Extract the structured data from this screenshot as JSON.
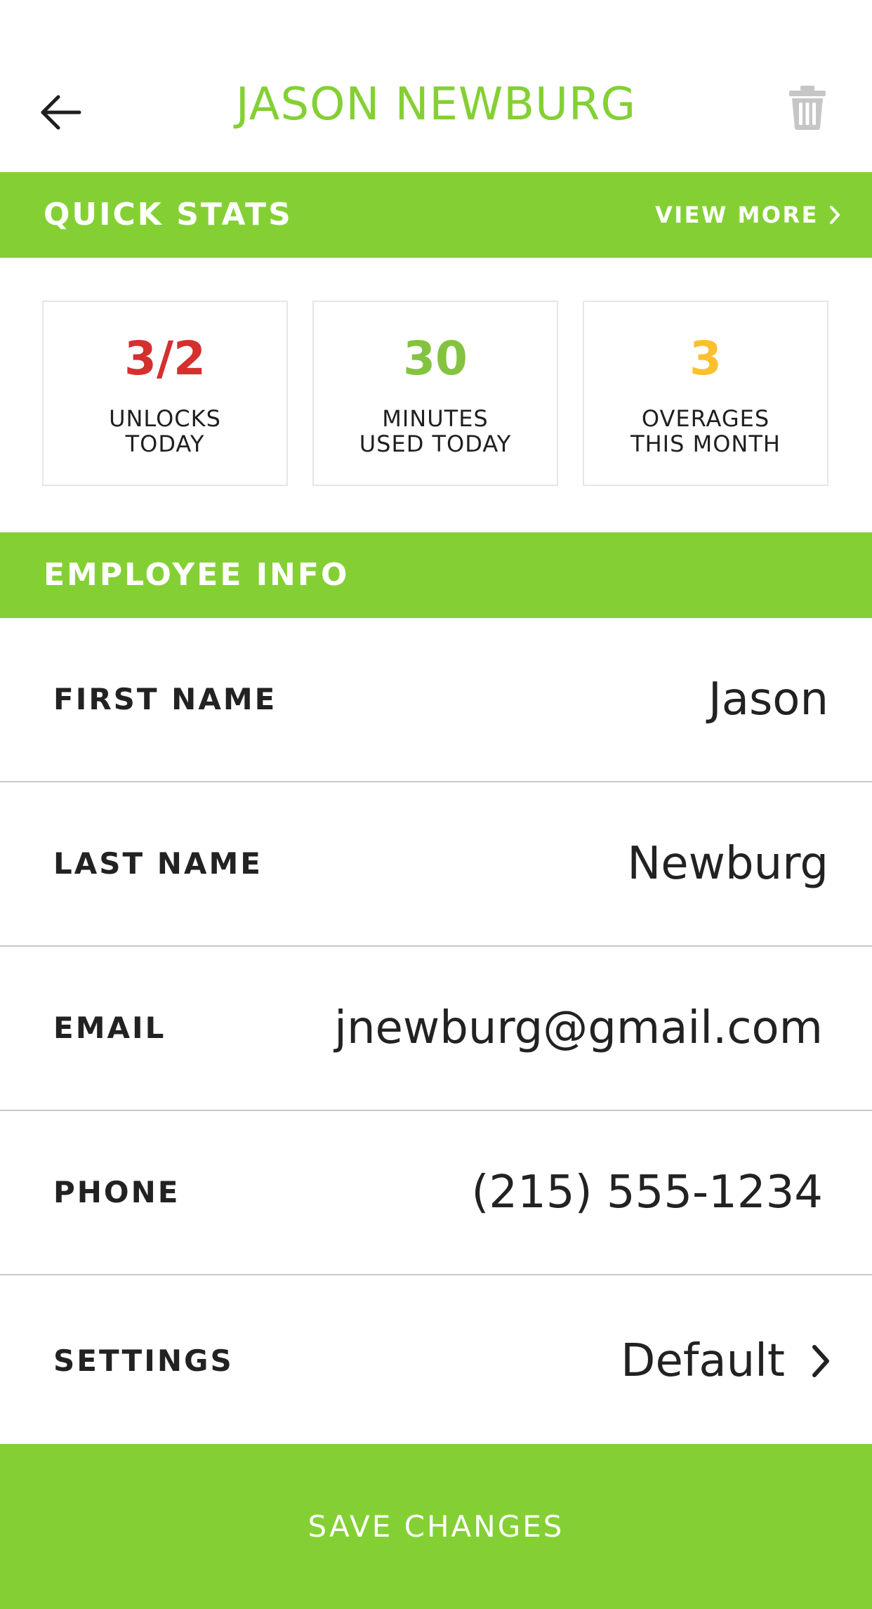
{
  "header": {
    "title": "JASON NEWBURG",
    "back_icon": "arrow-left-icon",
    "trash_icon": "trash-icon",
    "title_color": "#84d034"
  },
  "quick_stats": {
    "title": "QUICK STATS",
    "view_more_label": "VIEW MORE",
    "cards": [
      {
        "value": "3/2",
        "label": "UNLOCKS\nTODAY",
        "color": "#d3302f"
      },
      {
        "value": "30",
        "label": "MINUTES\nUSED TODAY",
        "color": "#84c341"
      },
      {
        "value": "3",
        "label": "OVERAGES\nTHIS MONTH",
        "color": "#fbc02d"
      }
    ]
  },
  "employee_info": {
    "title": "EMPLOYEE INFO",
    "fields": [
      {
        "label": "FIRST NAME",
        "value": "Jason"
      },
      {
        "label": "LAST NAME",
        "value": "Newburg"
      },
      {
        "label": "EMAIL",
        "value": "jnewburg@gmail.com"
      },
      {
        "label": "PHONE",
        "value": "(215) 555-1234"
      },
      {
        "label": "SETTINGS",
        "value": "Default"
      }
    ]
  },
  "footer": {
    "save_label": "SAVE CHANGES"
  },
  "colors": {
    "accent": "#84d034"
  }
}
